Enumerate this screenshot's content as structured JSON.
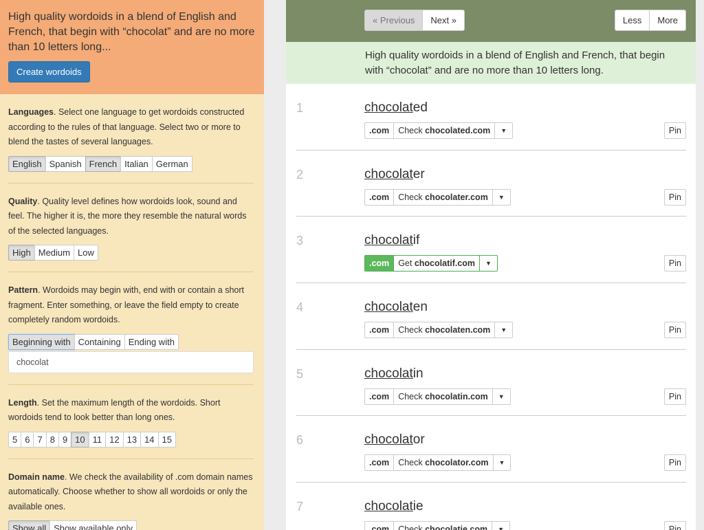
{
  "sidebar": {
    "summary": "High quality wordoids in a blend of English and French, that begin with “chocolat” and are no more than 10 letters long...",
    "create_button": "Create wordoids",
    "languages": {
      "title": "Languages",
      "desc": ". Select one language to get wordoids constructed according to the rules of that language. Select two or more to blend the tastes of several languages.",
      "options": [
        {
          "label": "English",
          "active": true
        },
        {
          "label": "Spanish",
          "active": false
        },
        {
          "label": "French",
          "active": true
        },
        {
          "label": "Italian",
          "active": false
        },
        {
          "label": "German",
          "active": false
        }
      ]
    },
    "quality": {
      "title": "Quality",
      "desc": ". Quality level defines how wordoids look, sound and feel. The higher it is, the more they resemble the natural words of the selected languages.",
      "options": [
        {
          "label": "High",
          "active": true
        },
        {
          "label": "Medium",
          "active": false
        },
        {
          "label": "Low",
          "active": false
        }
      ]
    },
    "pattern": {
      "title": "Pattern",
      "desc": ". Wordoids may begin with, end with or contain a short fragment. Enter something, or leave the field empty to create completely random wordoids.",
      "options": [
        {
          "label": "Beginning with",
          "active": true
        },
        {
          "label": "Containing",
          "active": false
        },
        {
          "label": "Ending with",
          "active": false
        }
      ],
      "input_value": "chocolat"
    },
    "length": {
      "title": "Length",
      "desc": ". Set the maximum length of the wordoids. Short wordoids tend to look better than long ones.",
      "options": [
        {
          "label": "5",
          "active": false
        },
        {
          "label": "6",
          "active": false
        },
        {
          "label": "7",
          "active": false
        },
        {
          "label": "8",
          "active": false
        },
        {
          "label": "9",
          "active": false
        },
        {
          "label": "10",
          "active": true
        },
        {
          "label": "11",
          "active": false
        },
        {
          "label": "12",
          "active": false
        },
        {
          "label": "13",
          "active": false
        },
        {
          "label": "14",
          "active": false
        },
        {
          "label": "15",
          "active": false
        }
      ]
    },
    "domain": {
      "title": "Domain name",
      "desc": ". We check the availability of .com domain names automatically. Choose whether to show all wordoids or only the available ones.",
      "options": [
        {
          "label": "Show all",
          "active": true
        },
        {
          "label": "Show available only",
          "active": false
        }
      ]
    }
  },
  "main": {
    "pager": {
      "previous": "« Previous",
      "next": "Next »",
      "less": "Less",
      "more": "More"
    },
    "info": "High quality wordoids in a blend of English and French, that begin with “chocolat” and are no more than 10 letters long.",
    "results": [
      {
        "num": "1",
        "prefix": "chocolat",
        "suffix": "ed",
        "tld": ".com",
        "action": "Check",
        "domain": "chocolated.com",
        "available": false,
        "pin": "Pin"
      },
      {
        "num": "2",
        "prefix": "chocolat",
        "suffix": "er",
        "tld": ".com",
        "action": "Check",
        "domain": "chocolater.com",
        "available": false,
        "pin": "Pin"
      },
      {
        "num": "3",
        "prefix": "chocolat",
        "suffix": "if",
        "tld": ".com",
        "action": "Get",
        "domain": "chocolatif.com",
        "available": true,
        "pin": "Pin"
      },
      {
        "num": "4",
        "prefix": "chocolat",
        "suffix": "en",
        "tld": ".com",
        "action": "Check",
        "domain": "chocolaten.com",
        "available": false,
        "pin": "Pin"
      },
      {
        "num": "5",
        "prefix": "chocolat",
        "suffix": "in",
        "tld": ".com",
        "action": "Check",
        "domain": "chocolatin.com",
        "available": false,
        "pin": "Pin"
      },
      {
        "num": "6",
        "prefix": "chocolat",
        "suffix": "or",
        "tld": ".com",
        "action": "Check",
        "domain": "chocolator.com",
        "available": false,
        "pin": "Pin"
      },
      {
        "num": "7",
        "prefix": "chocolat",
        "suffix": "ie",
        "tld": ".com",
        "action": "Check",
        "domain": "chocolatie.com",
        "available": false,
        "pin": "Pin"
      }
    ]
  }
}
